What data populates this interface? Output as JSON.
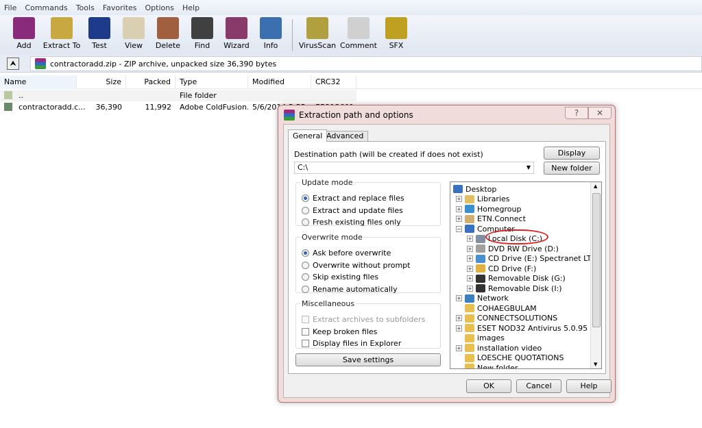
{
  "menu": [
    "File",
    "Commands",
    "Tools",
    "Favorites",
    "Options",
    "Help"
  ],
  "toolbar": [
    {
      "label": "Add",
      "icon": "add-archive-icon",
      "color": "#8a2a7a"
    },
    {
      "label": "Extract To",
      "icon": "extract-to-icon",
      "color": "#c8a840"
    },
    {
      "label": "Test",
      "icon": "test-icon",
      "color": "#1e3a8a"
    },
    {
      "label": "View",
      "icon": "view-icon",
      "color": "#d8d0b0"
    },
    {
      "label": "Delete",
      "icon": "delete-icon",
      "color": "#a06040"
    },
    {
      "label": "Find",
      "icon": "find-icon",
      "color": "#404040"
    },
    {
      "label": "Wizard",
      "icon": "wizard-icon",
      "color": "#8a3a6a"
    },
    {
      "label": "Info",
      "icon": "info-icon",
      "color": "#3a70b0"
    },
    {
      "label": "VirusScan",
      "icon": "virusscan-icon",
      "color": "#b0a040"
    },
    {
      "label": "Comment",
      "icon": "comment-icon",
      "color": "#d0d0d0"
    },
    {
      "label": "SFX",
      "icon": "sfx-icon",
      "color": "#c0a020"
    }
  ],
  "address": "contractoradd.zip - ZIP archive, unpacked size 36,390 bytes",
  "columns": [
    "Name",
    "Size",
    "Packed",
    "Type",
    "Modified",
    "CRC32"
  ],
  "files": [
    {
      "name": "..",
      "size": "",
      "packed": "",
      "type": "File folder",
      "modified": "",
      "crc": ""
    },
    {
      "name": "contractoradd.c...",
      "size": "36,390",
      "packed": "11,992",
      "type": "Adobe ColdFusion...",
      "modified": "5/6/2014 5:55",
      "crc": "7B213601"
    }
  ],
  "dialog": {
    "title": "Extraction path and options",
    "help_btn": "?",
    "close_btn": "✕",
    "tabs": [
      "General",
      "Advanced"
    ],
    "dest_label": "Destination path (will be created if does not exist)",
    "dest_value": "C:\\",
    "display_btn": "Display",
    "new_folder_btn": "New folder",
    "update_mode": {
      "title": "Update mode",
      "options": [
        "Extract and replace files",
        "Extract and update files",
        "Fresh existing files only"
      ],
      "selected": 0
    },
    "overwrite_mode": {
      "title": "Overwrite mode",
      "options": [
        "Ask before overwrite",
        "Overwrite without prompt",
        "Skip existing files",
        "Rename automatically"
      ],
      "selected": 0
    },
    "misc": {
      "title": "Miscellaneous",
      "options": [
        {
          "label": "Extract archives to subfolders",
          "checked": false,
          "disabled": true
        },
        {
          "label": "Keep broken files",
          "checked": false,
          "disabled": false
        },
        {
          "label": "Display files in Explorer",
          "checked": false,
          "disabled": false
        }
      ]
    },
    "save_btn": "Save settings",
    "tree": [
      {
        "label": "Desktop",
        "level": 0,
        "exp": "",
        "color": "#3a70c0"
      },
      {
        "label": "Libraries",
        "level": 1,
        "exp": "+",
        "color": "#e0c060"
      },
      {
        "label": "Homegroup",
        "level": 1,
        "exp": "+",
        "color": "#3a90d0"
      },
      {
        "label": "ETN.Connect",
        "level": 1,
        "exp": "+",
        "color": "#d0b070"
      },
      {
        "label": "Computer",
        "level": 1,
        "exp": "-",
        "color": "#3a70c0"
      },
      {
        "label": "Local Disk (C:)",
        "level": 2,
        "exp": "+",
        "color": "#8090a0"
      },
      {
        "label": "DVD RW Drive (D:)",
        "level": 2,
        "exp": "+",
        "color": "#a0a0a0"
      },
      {
        "label": "CD Drive (E:) Spectranet LTE",
        "level": 2,
        "exp": "+",
        "color": "#4a90d0"
      },
      {
        "label": "CD Drive (F:)",
        "level": 2,
        "exp": "+",
        "color": "#e0b040"
      },
      {
        "label": "Removable Disk (G:)",
        "level": 2,
        "exp": "+",
        "color": "#333333"
      },
      {
        "label": "Removable Disk (I:)",
        "level": 2,
        "exp": "+",
        "color": "#333333"
      },
      {
        "label": "Network",
        "level": 1,
        "exp": "+",
        "color": "#3a80c0"
      },
      {
        "label": "COHAEGBULAM",
        "level": 1,
        "exp": "",
        "color": "#e8c050"
      },
      {
        "label": "CONNECTSOLUTIONS",
        "level": 1,
        "exp": "+",
        "color": "#e8c050"
      },
      {
        "label": "ESET NOD32 Antivirus 5.0.95",
        "level": 1,
        "exp": "+",
        "color": "#e8c050"
      },
      {
        "label": "images",
        "level": 1,
        "exp": "",
        "color": "#e8c050"
      },
      {
        "label": "installation video",
        "level": 1,
        "exp": "+",
        "color": "#e8c050"
      },
      {
        "label": "LOESCHE QUOTATIONS",
        "level": 1,
        "exp": "",
        "color": "#e8c050"
      },
      {
        "label": "New folder",
        "level": 1,
        "exp": "",
        "color": "#e8c050"
      }
    ],
    "ok_btn": "OK",
    "cancel_btn": "Cancel",
    "help_label": "Help"
  }
}
